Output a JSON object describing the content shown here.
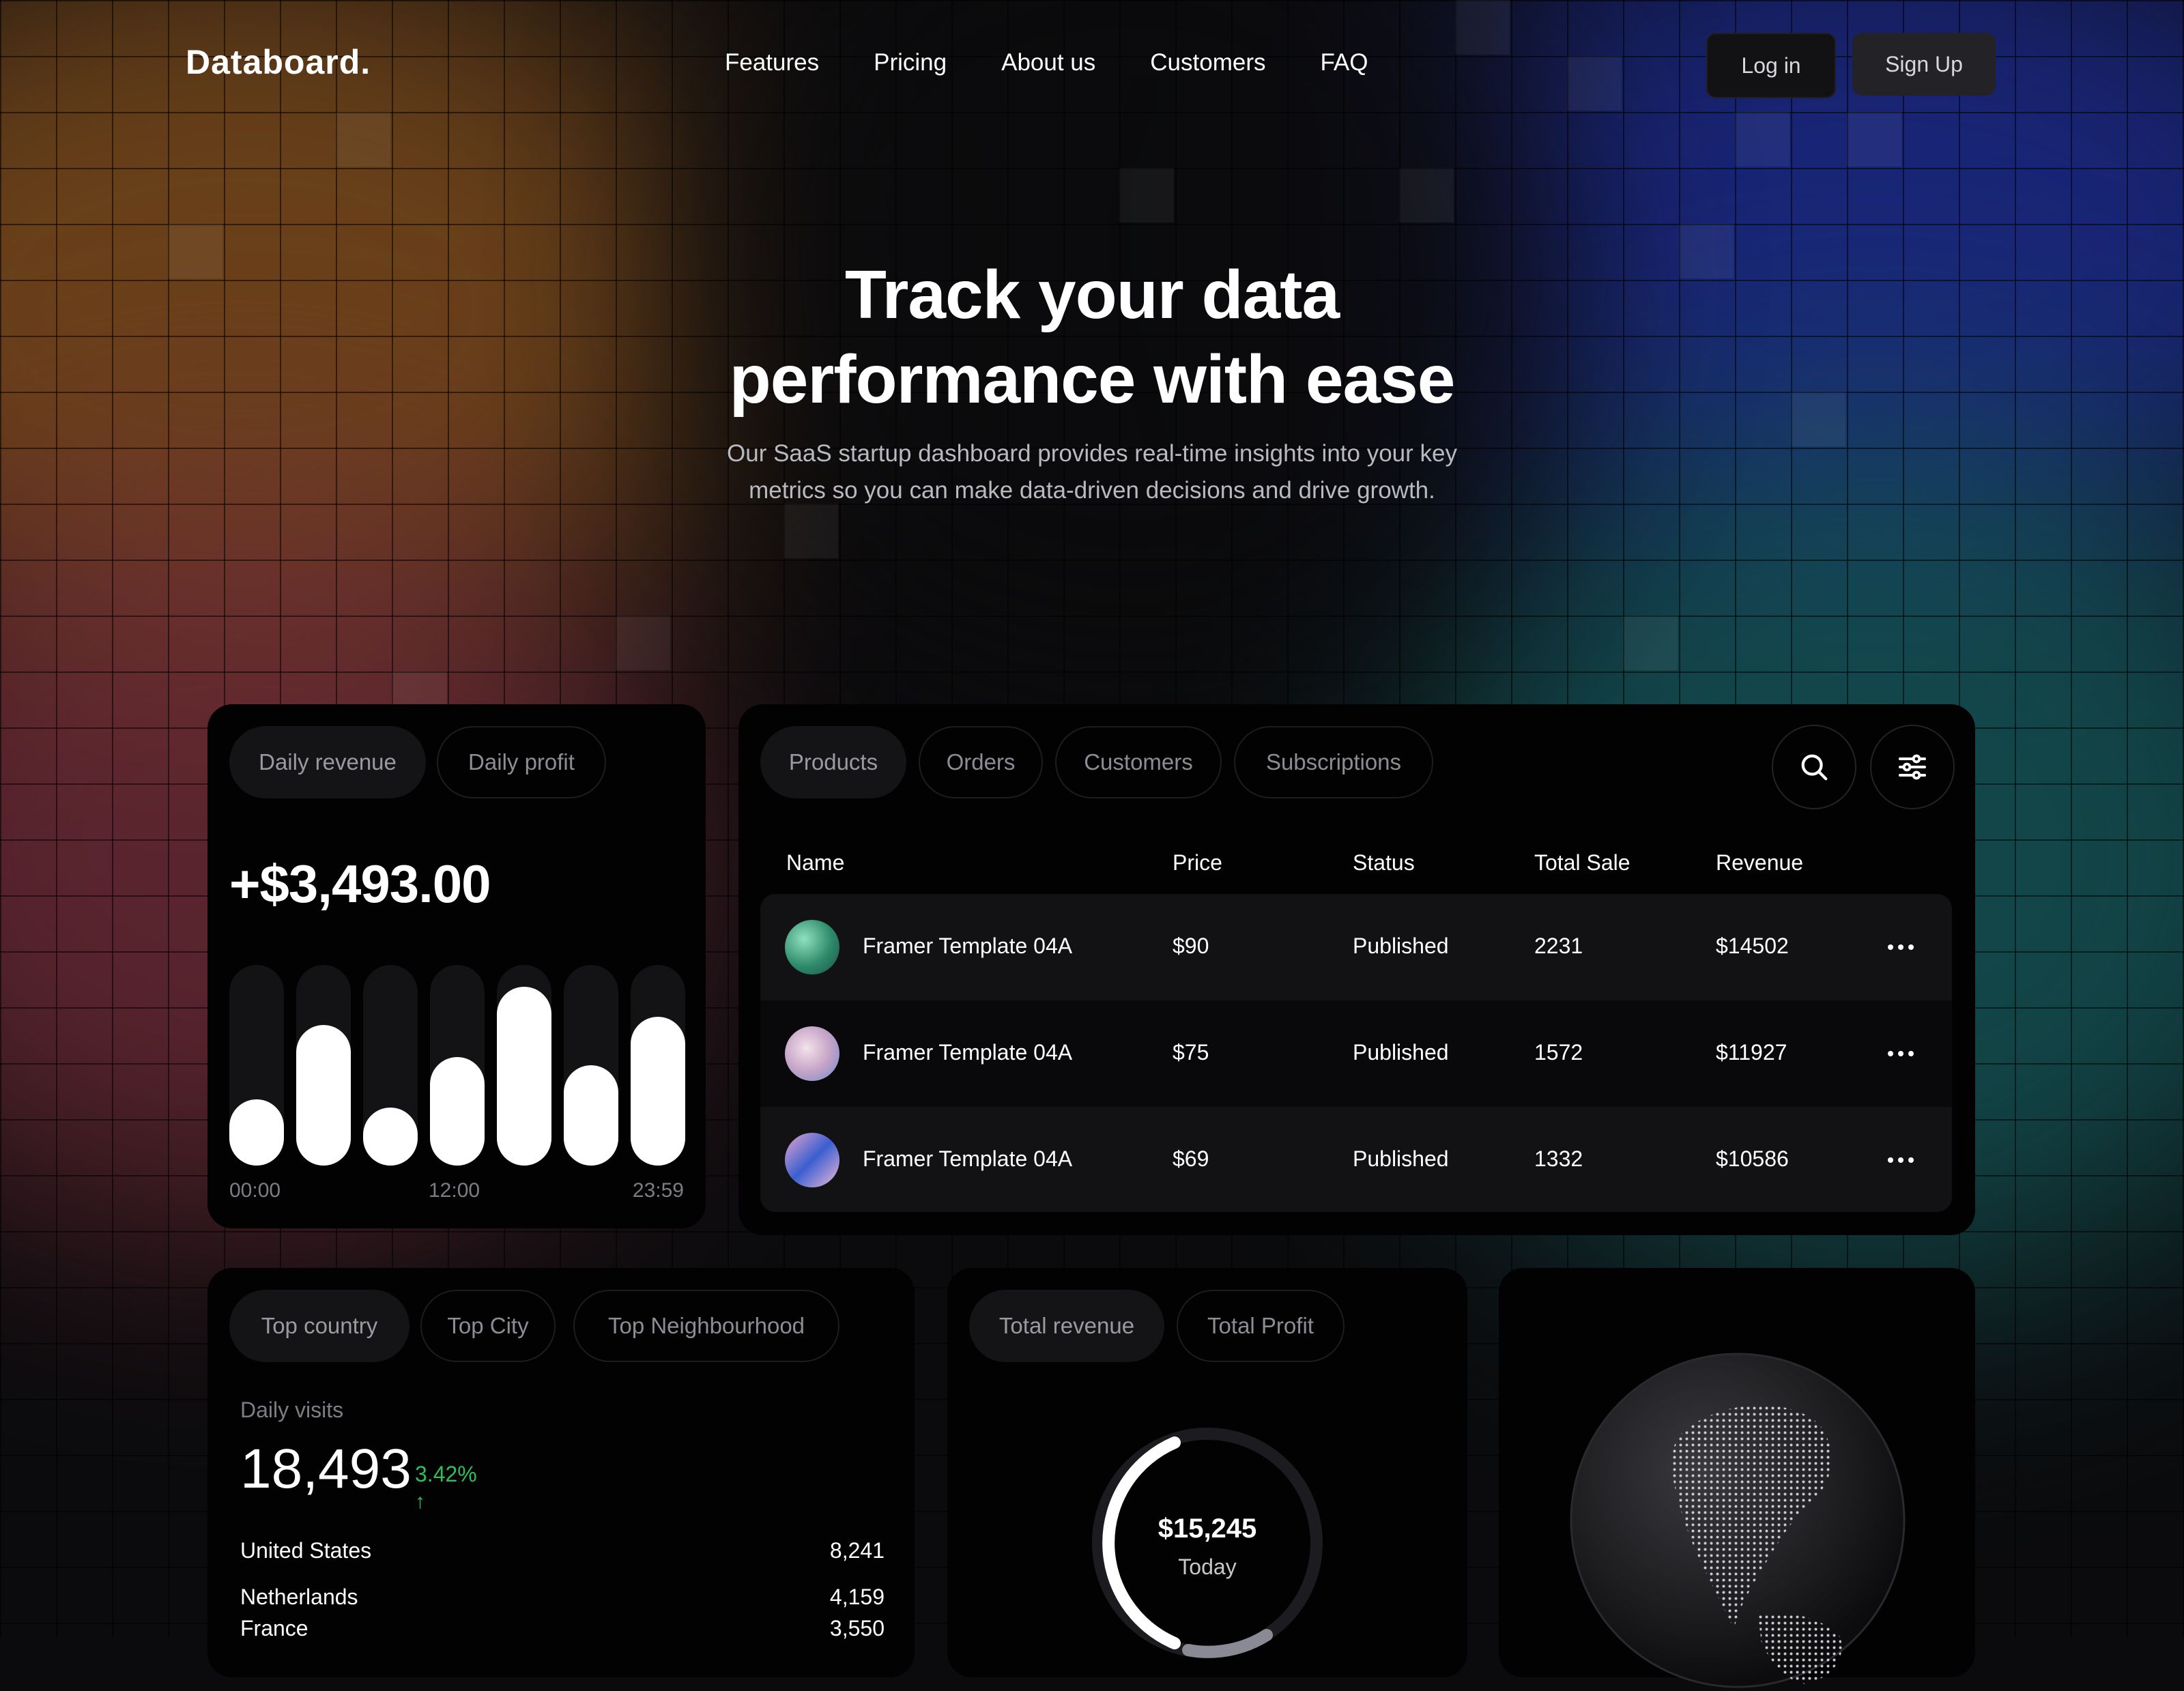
{
  "brand": {
    "logo": "Databoard."
  },
  "nav": {
    "items": [
      "Features",
      "Pricing",
      "About us",
      "Customers",
      "FAQ"
    ],
    "login": "Log in",
    "signup": "Sign Up"
  },
  "hero": {
    "title_line1": "Track your data",
    "title_line2": "performance with ease",
    "subtitle_line1": "Our SaaS startup dashboard provides real-time insights into your key",
    "subtitle_line2": "metrics so you can make data-driven decisions and drive growth."
  },
  "revenue_card": {
    "tabs": [
      "Daily revenue",
      "Daily profit"
    ],
    "amount": "+$3,493.00",
    "times": [
      "00:00",
      "12:00",
      "23:59"
    ],
    "chart_data": {
      "type": "bar",
      "values": [
        0.33,
        0.7,
        0.29,
        0.54,
        0.89,
        0.5,
        0.74
      ],
      "ylim": [
        0,
        1
      ]
    }
  },
  "products_card": {
    "tabs": [
      "Products",
      "Orders",
      "Customers",
      "Subscriptions"
    ],
    "icons": {
      "search": "search-icon",
      "filter": "sliders-icon"
    },
    "columns": [
      "Name",
      "Price",
      "Status",
      "Total Sale",
      "Revenue"
    ],
    "rows": [
      {
        "name": "Framer Template 04A",
        "price": "$90",
        "status": "Published",
        "total_sale": "2231",
        "revenue": "$14502"
      },
      {
        "name": "Framer Template 04A",
        "price": "$75",
        "status": "Published",
        "total_sale": "1572",
        "revenue": "$11927"
      },
      {
        "name": "Framer Template 04A",
        "price": "$69",
        "status": "Published",
        "total_sale": "1332",
        "revenue": "$10586"
      }
    ]
  },
  "location_card": {
    "tabs": [
      "Top country",
      "Top City",
      "Top Neighbourhood"
    ],
    "label": "Daily visits",
    "value": "18,493",
    "change": "3.42%",
    "change_arrow": "↑",
    "countries": [
      {
        "name": "United States",
        "value": "8,241"
      },
      {
        "name": "Netherlands",
        "value": "4,159"
      },
      {
        "name": "France",
        "value": "3,550"
      }
    ]
  },
  "total_card": {
    "tabs": [
      "Total revenue",
      "Total Profit"
    ],
    "amount": "$15,245",
    "label": "Today"
  }
}
